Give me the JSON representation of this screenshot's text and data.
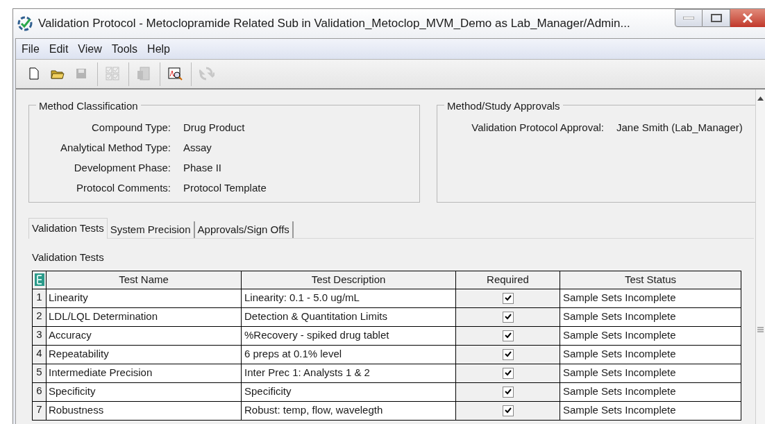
{
  "window": {
    "title": "Validation Protocol - Metoclopramide Related Sub in Validation_Metoclop_MVM_Demo as Lab_Manager/Admin..."
  },
  "menu": [
    "File",
    "Edit",
    "View",
    "Tools",
    "Help"
  ],
  "toolbar": [
    {
      "kind": "new",
      "disabled": false
    },
    {
      "kind": "open",
      "disabled": false
    },
    {
      "kind": "save",
      "disabled": true
    },
    {
      "kind": "checks",
      "disabled": true
    },
    {
      "kind": "report",
      "disabled": true
    },
    {
      "kind": "chart",
      "disabled": false
    },
    {
      "kind": "refresh",
      "disabled": true
    }
  ],
  "method_classification": {
    "title": "Method Classification",
    "fields": [
      {
        "label": "Compound Type:",
        "value": "Drug Product"
      },
      {
        "label": "Analytical Method Type:",
        "value": "Assay"
      },
      {
        "label": "Development Phase:",
        "value": "Phase II"
      },
      {
        "label": "Protocol Comments:",
        "value": "Protocol Template"
      }
    ]
  },
  "approvals": {
    "title": "Method/Study Approvals",
    "fields": [
      {
        "label": "Validation Protocol Approval:",
        "value": "Jane Smith (Lab_Manager)"
      }
    ]
  },
  "tabs": [
    {
      "label": "Validation Tests",
      "selected": true
    },
    {
      "label": "System Precision",
      "selected": false
    },
    {
      "label": "Approvals/Sign Offs",
      "selected": false
    }
  ],
  "table": {
    "caption": "Validation Tests",
    "columns": [
      "Test Name",
      "Test Description",
      "Required",
      "Test Status"
    ],
    "rows": [
      {
        "index": "1",
        "name": "Linearity",
        "description": "Linearity: 0.1 - 5.0 ug/mL",
        "required": true,
        "status": "Sample Sets Incomplete"
      },
      {
        "index": "2",
        "name": "LDL/LQL Determination",
        "description": "Detection & Quantitation Limits",
        "required": true,
        "status": "Sample Sets Incomplete"
      },
      {
        "index": "3",
        "name": "Accuracy",
        "description": "%Recovery - spiked drug tablet",
        "required": true,
        "status": "Sample Sets Incomplete"
      },
      {
        "index": "4",
        "name": "Repeatability",
        "description": "6 preps at 0.1% level",
        "required": true,
        "status": "Sample Sets Incomplete"
      },
      {
        "index": "5",
        "name": "Intermediate Precision",
        "description": "Inter Prec 1: Analysts 1 & 2",
        "required": true,
        "status": "Sample Sets Incomplete"
      },
      {
        "index": "6",
        "name": "Specificity",
        "description": "Specificity",
        "required": true,
        "status": "Sample Sets Incomplete"
      },
      {
        "index": "7",
        "name": "Robustness",
        "description": "Robust: temp, flow, wavelegth",
        "required": true,
        "status": "Sample Sets Incomplete"
      }
    ]
  }
}
